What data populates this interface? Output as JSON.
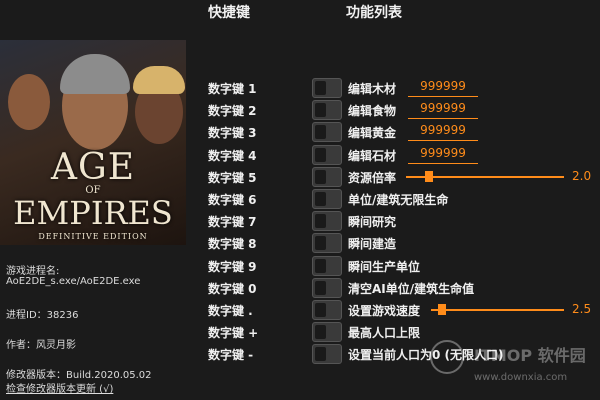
{
  "header": {
    "hotkeys": "快捷键",
    "functions": "功能列表"
  },
  "cover": {
    "line1": "AGE",
    "line2": "OF",
    "line3": "EMPIRES",
    "line4": "DEFINITIVE EDITION"
  },
  "info": {
    "process_label": "游戏进程名:",
    "process_value": "AoE2DE_s.exe/AoE2DE.exe",
    "pid": "进程ID：38236",
    "author": "作者：风灵月影",
    "version": "修改器版本：Build.2020.05.02",
    "update_link": "检查修改器版本更新 (√)"
  },
  "rows": [
    {
      "key": "数字键 1",
      "name": "编辑木材",
      "value": "999999"
    },
    {
      "key": "数字键 2",
      "name": "编辑食物",
      "value": "999999"
    },
    {
      "key": "数字键 3",
      "name": "编辑黄金",
      "value": "999999"
    },
    {
      "key": "数字键 4",
      "name": "编辑石材",
      "value": "999999"
    },
    {
      "key": "数字键 5",
      "name": "资源倍率",
      "slider": "2.0",
      "slider_fraction": 0.12
    },
    {
      "key": "数字键 6",
      "name": "单位/建筑无限生命"
    },
    {
      "key": "数字键 7",
      "name": "瞬间研究"
    },
    {
      "key": "数字键 8",
      "name": "瞬间建造"
    },
    {
      "key": "数字键 9",
      "name": "瞬间生产单位"
    },
    {
      "key": "数字键 0",
      "name": "清空AI单位/建筑生命值"
    },
    {
      "key": "数字键 .",
      "name": "设置游戏速度",
      "slider": "2.5",
      "slider_fraction": 0.05
    },
    {
      "key": "数字键 +",
      "name": "最高人口上限"
    },
    {
      "key": "数字键 -",
      "name": "设置当前人口为0 (无限人口)"
    }
  ],
  "watermark": {
    "text": "ITMOP 软件园",
    "url": "www.downxia.com"
  },
  "colors": {
    "accent": "#ff8c1a",
    "background": "#1b1b1b"
  }
}
